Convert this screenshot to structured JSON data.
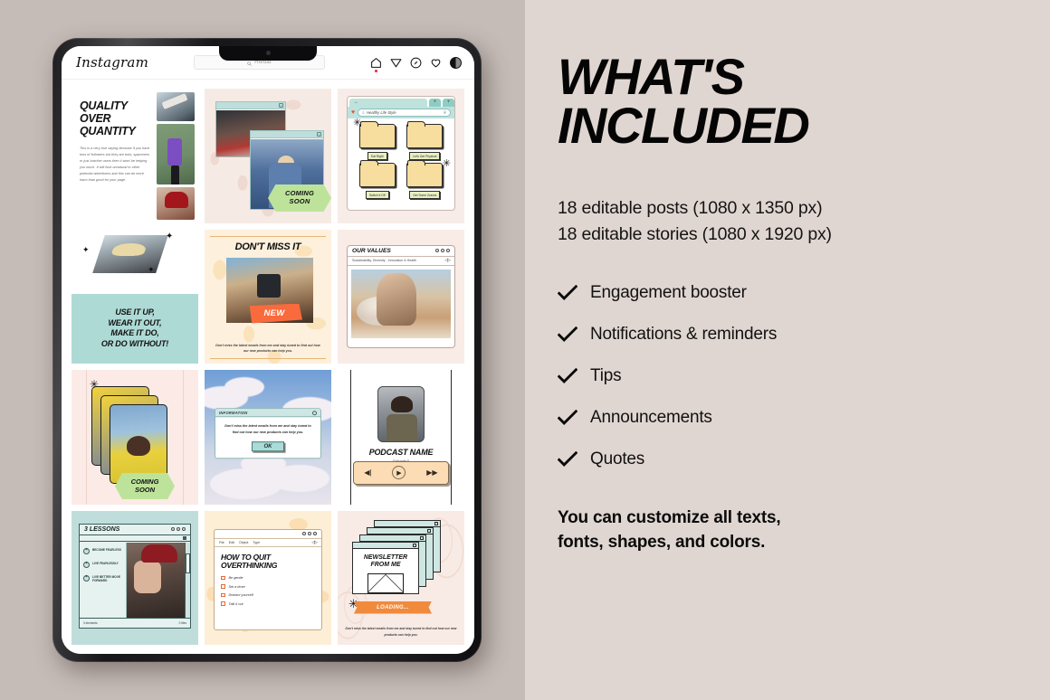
{
  "colors": {
    "left_bg": "#c5bcb7",
    "right_bg": "#e0d6d1",
    "accent_mint": "#bfdedb",
    "accent_orange": "#f08a3c",
    "accent_green": "#bde39a",
    "text": "#111111"
  },
  "instagram": {
    "logo": "Instagram",
    "search": {
      "placeholder": "Hledat",
      "icon": "search-icon"
    },
    "icons": [
      "home-icon",
      "paper-plane-icon",
      "compass-icon",
      "heart-icon",
      "profile-avatar-icon"
    ]
  },
  "grid": {
    "post1": {
      "title": "QUALITY\nOVER\nQUANTITY",
      "title_lines": [
        "QUALITY",
        "OVER",
        "QUANTITY"
      ],
      "body": "This is a very true saying because if you have tons of followers but they are bots, spammers or just inactive users then it wont be helping you much. It will look unnatural to other potential advertisers and this can do more harm than good for your page."
    },
    "post2": {
      "badge": "COMING\nSOON",
      "badge_line1": "COMING",
      "badge_line2": "SOON"
    },
    "post3": {
      "address_value": "Healthy Life Style",
      "folders": [
        "Eat Right",
        "Let's Get Physical",
        "Switch it Off",
        "Get Some Zzzzzs"
      ]
    },
    "post4": {
      "lines": [
        "USE IT UP,",
        "WEAR IT OUT,",
        "MAKE IT DO,",
        "OR DO WITHOUT!"
      ]
    },
    "post5": {
      "title": "DON'T MISS IT",
      "badge": "NEW",
      "caption": "Don't miss the latest emails from me and stay tuned to find out how our new products can help you."
    },
    "post6": {
      "title": "OUR VALUES",
      "subtitle": "Sustainability, Diversity , Innovation & Health"
    },
    "post7": {
      "badge_line1": "COMING",
      "badge_line2": "SOON"
    },
    "post8": {
      "dialog_title": "INFORMATION",
      "message": "Don't miss the latest emails from me and stay tuned to find out how our new products can help you.",
      "button": "OK"
    },
    "post9": {
      "title": "PODCAST NAME",
      "episode": "Episode 5",
      "controls": [
        "prev-button",
        "play-button",
        "next-button"
      ]
    },
    "post10": {
      "title": "3 LESSONS",
      "items": [
        "BECOME FEARLESS",
        "LIVE FEARLESSLY",
        "LIVE BETTER MOVE FORWARD"
      ],
      "footer_left": "3 elements",
      "footer_right": "0 files"
    },
    "post11": {
      "menu": [
        "File",
        "Edit",
        "Object",
        "Type"
      ],
      "title_line1": "HOW TO QUIT",
      "title_line2": "OVERTHINKING",
      "checklist": [
        "Be gentle",
        "Set a timer",
        "Distract yourself",
        "Talk it out"
      ]
    },
    "post12": {
      "title_line1": "NEWSLETTER",
      "title_line2": "FROM ME",
      "banner": "LOADING...",
      "caption": "Don't miss the latest emails from me and stay tuned to find out how our new products can help you."
    }
  },
  "right": {
    "headline_line1": "WHAT'S",
    "headline_line2": "INCLUDED",
    "sizes_line1": "18 editable posts (1080 x 1350 px)",
    "sizes_line2": "18 editable stories (1080 x 1920 px)",
    "features": [
      "Engagement booster",
      "Notifications & reminders",
      "Tips",
      "Announcements",
      "Quotes"
    ],
    "closing_line1": "You can customize all texts,",
    "closing_line2": "fonts, shapes, and colors."
  }
}
